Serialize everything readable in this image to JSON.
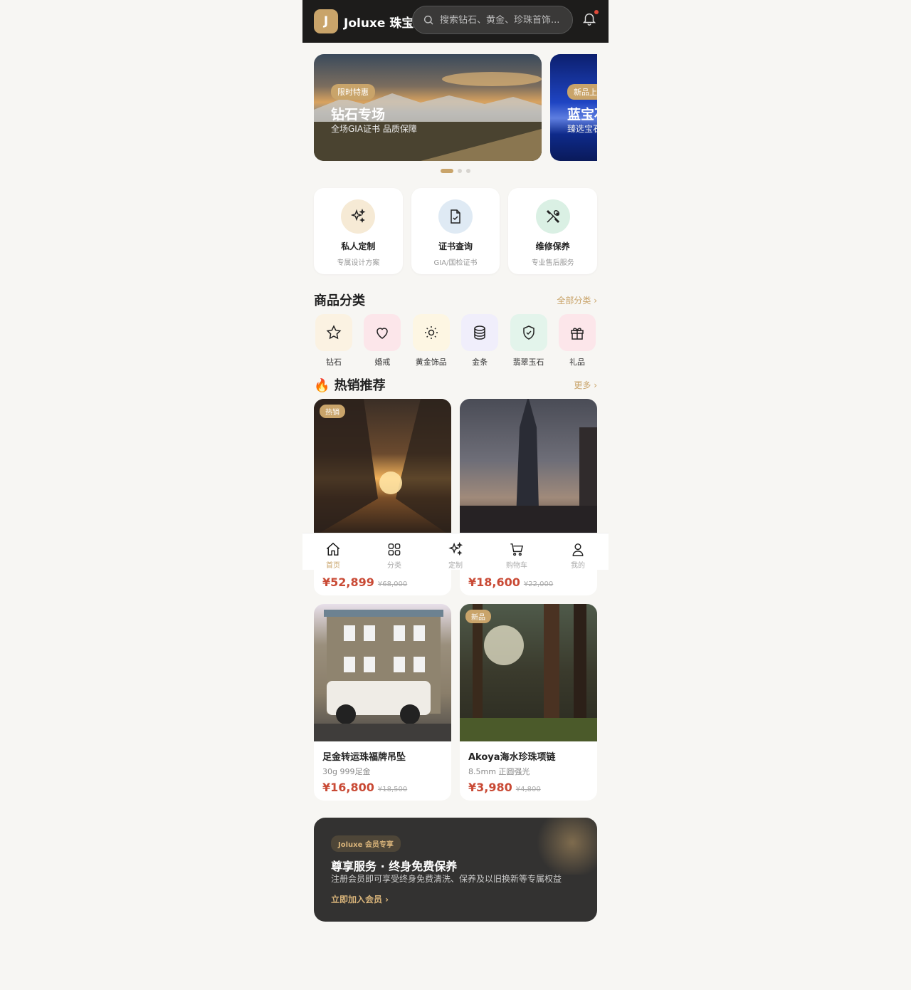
{
  "header": {
    "logo_letter": "J",
    "brand": "Joluxe 珠宝",
    "search_placeholder": "搜索钻石、黄金、珍珠首饰...",
    "notification_icon": "bell-icon"
  },
  "banners": [
    {
      "tag": "限时特惠",
      "title": "钻石专场",
      "subtitle": "全场GIA证书 品质保障"
    },
    {
      "tag": "新品上市",
      "title": "蓝宝石系列",
      "subtitle": "臻选宝石 匠心"
    }
  ],
  "banner_dots": {
    "count": 3,
    "active": 1
  },
  "services": [
    {
      "icon": "sparkles-icon",
      "title": "私人定制",
      "subtitle": "专属设计方案",
      "bg": "#f6ead5"
    },
    {
      "icon": "document-check-icon",
      "title": "证书查询",
      "subtitle": "GIA/国检证书",
      "bg": "#dfeaf4"
    },
    {
      "icon": "tools-icon",
      "title": "维修保养",
      "subtitle": "专业售后服务",
      "bg": "#daf0e4"
    }
  ],
  "categories_section": {
    "title": "商品分类",
    "more": "全部分类 ›"
  },
  "categories": [
    {
      "icon": "star-icon",
      "label": "钻石",
      "bg": "#fbf2e2"
    },
    {
      "icon": "heart-icon",
      "label": "婚戒",
      "bg": "#fce6ea"
    },
    {
      "icon": "sun-icon",
      "label": "黄金饰品",
      "bg": "#fdf6e3"
    },
    {
      "icon": "coins-icon",
      "label": "金条",
      "bg": "#f0eefb"
    },
    {
      "icon": "shield-check-icon",
      "label": "翡翠玉石",
      "bg": "#e3f4eb"
    },
    {
      "icon": "gift-icon",
      "label": "礼品",
      "bg": "#fce6ea"
    }
  ],
  "products_section": {
    "title": "🔥 热销推荐",
    "more": "更多 ›"
  },
  "products": [
    {
      "badge": "热销",
      "name": "",
      "spec": "",
      "price": "¥52,899",
      "original": "¥68,000",
      "img": "street"
    },
    {
      "badge": "",
      "name": "",
      "spec": "",
      "price": "¥18,600",
      "original": "¥22,000",
      "img": "tower"
    },
    {
      "badge": "",
      "name": "足金转运珠福牌吊坠",
      "spec": "30g 999足金",
      "price": "¥16,800",
      "original": "¥18,500",
      "img": "house"
    },
    {
      "badge": "新品",
      "name": "Akoya海水珍珠项链",
      "spec": "8.5mm 正圆强光",
      "price": "¥3,980",
      "original": "¥4,800",
      "img": "forest"
    }
  ],
  "promo": {
    "tag": "Joluxe 会员专享",
    "title": "尊享服务 · 终身免费保养",
    "subtitle": "注册会员即可享受终身免费清洗、保养及以旧换新等专属权益",
    "link": "立即加入会员 ›"
  },
  "bottom_nav": [
    {
      "icon": "home-icon",
      "label": "首页",
      "active": true
    },
    {
      "icon": "grid-icon",
      "label": "分类",
      "active": false
    },
    {
      "icon": "sparkles-icon",
      "label": "定制",
      "active": false
    },
    {
      "icon": "cart-icon",
      "label": "购物车",
      "active": false
    },
    {
      "icon": "user-icon",
      "label": "我的",
      "active": false
    }
  ],
  "colors": {
    "accent": "#c9a46a",
    "header_bg": "#1d1c1b",
    "price": "#c94a35",
    "page_bg": "#f7f6f3"
  }
}
